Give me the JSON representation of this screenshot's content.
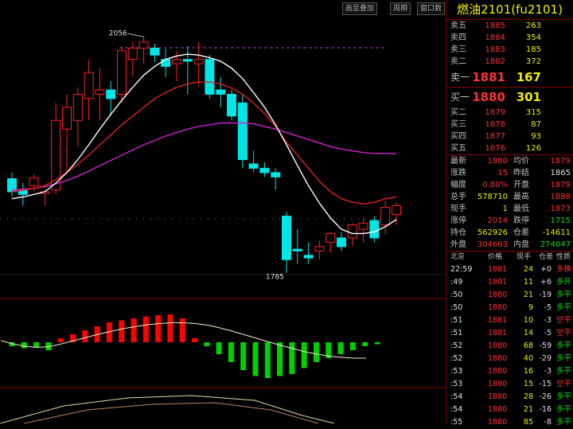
{
  "toolbar": {
    "buttons": [
      "画显叠加",
      "周期",
      "窗口数"
    ]
  },
  "chart": {
    "high_label": "2056",
    "low_label": "1785"
  },
  "colors": {
    "up": "#ff2020",
    "down": "#00e6e6",
    "ma_white": "#ffffff",
    "ma_red": "#e02020",
    "ma_magenta": "#d020d0",
    "macd_up": "#ff0000",
    "macd_down": "#00d000"
  },
  "panel": {
    "title": "燃油2101(fu2101)",
    "asks": [
      {
        "label": "卖五",
        "price": "1885",
        "vol": "263"
      },
      {
        "label": "卖四",
        "price": "1884",
        "vol": "354"
      },
      {
        "label": "卖三",
        "price": "1883",
        "vol": "185"
      },
      {
        "label": "卖二",
        "price": "1882",
        "vol": "372"
      },
      {
        "label": "卖一",
        "price": "1881",
        "vol": "167"
      }
    ],
    "bids": [
      {
        "label": "买一",
        "price": "1880",
        "vol": "301"
      },
      {
        "label": "买二",
        "price": "1879",
        "vol": "315"
      },
      {
        "label": "买三",
        "price": "1878",
        "vol": "87"
      },
      {
        "label": "买四",
        "price": "1877",
        "vol": "93"
      },
      {
        "label": "买五",
        "price": "1876",
        "vol": "126"
      }
    ],
    "stats": [
      {
        "l1": "最新",
        "v1": "1880",
        "l2": "均价",
        "v2": "1879"
      },
      {
        "l1": "涨跌",
        "v1": "15",
        "l2": "昨结",
        "v2": "1865"
      },
      {
        "l1": "幅度",
        "v1": "0.80%",
        "l2": "开盘",
        "v2": "1879"
      },
      {
        "l1": "总手",
        "v1": "578710",
        "l2": "最高",
        "v2": "1888"
      },
      {
        "l1": "现手",
        "v1": "1",
        "l2": "最低",
        "v2": "1873"
      },
      {
        "l1": "涨停",
        "v1": "2014",
        "l2": "跌停",
        "v2": "1715"
      },
      {
        "l1": "持仓",
        "v1": "562926",
        "l2": "仓差",
        "v2": "-14611"
      },
      {
        "l1": "外盘",
        "v1": "304663",
        "l2": "内盘",
        "v2": "274047"
      }
    ],
    "trade_headers": [
      "北京",
      "价格",
      "现手",
      "仓差",
      "性质"
    ],
    "trades": [
      {
        "time": "22:59",
        "price": "1881",
        "vol": "24",
        "diff": "+0",
        "nature": "多换"
      },
      {
        "time": ":49",
        "price": "1881",
        "vol": "11",
        "diff": "+6",
        "nature": "多开"
      },
      {
        "time": ":50",
        "price": "1880",
        "vol": "21",
        "diff": "-19",
        "nature": "多平"
      },
      {
        "time": ":50",
        "price": "1880",
        "vol": "9",
        "diff": "-5",
        "nature": "多平"
      },
      {
        "time": ":51",
        "price": "1881",
        "vol": "10",
        "diff": "-3",
        "nature": "空平"
      },
      {
        "time": ":51",
        "price": "1881",
        "vol": "14",
        "diff": "-5",
        "nature": "空平"
      },
      {
        "time": ":52",
        "price": "1880",
        "vol": "68",
        "diff": "-59",
        "nature": "多平"
      },
      {
        "time": ":52",
        "price": "1880",
        "vol": "40",
        "diff": "-29",
        "nature": "多平"
      },
      {
        "time": ":53",
        "price": "1880",
        "vol": "16",
        "diff": "-3",
        "nature": "多平"
      },
      {
        "time": ":53",
        "price": "1880",
        "vol": "15",
        "diff": "-15",
        "nature": "空平"
      },
      {
        "time": ":54",
        "price": "1880",
        "vol": "28",
        "diff": "-26",
        "nature": "多平"
      },
      {
        "time": ":54",
        "price": "1880",
        "vol": "21",
        "diff": "-16",
        "nature": "多平"
      },
      {
        "time": ":55",
        "price": "1880",
        "vol": "85",
        "diff": "-8",
        "nature": "多平"
      }
    ]
  },
  "chart_data": {
    "type": "candlestick",
    "title": "",
    "candles": [
      {
        "o": 1893,
        "h": 1900,
        "l": 1872,
        "c": 1878
      },
      {
        "o": 1880,
        "h": 1888,
        "l": 1862,
        "c": 1875
      },
      {
        "o": 1885,
        "h": 1898,
        "l": 1878,
        "c": 1894
      },
      {
        "o": 1876,
        "h": 1880,
        "l": 1862,
        "c": 1878
      },
      {
        "o": 1880,
        "h": 1980,
        "l": 1875,
        "c": 1960
      },
      {
        "o": 1950,
        "h": 1990,
        "l": 1900,
        "c": 1975
      },
      {
        "o": 1960,
        "h": 1998,
        "l": 1930,
        "c": 1990
      },
      {
        "o": 1985,
        "h": 2030,
        "l": 1960,
        "c": 2015
      },
      {
        "o": 1990,
        "h": 2020,
        "l": 1960,
        "c": 1995
      },
      {
        "o": 1995,
        "h": 2005,
        "l": 1965,
        "c": 1985
      },
      {
        "o": 1990,
        "h": 2045,
        "l": 1980,
        "c": 2040
      },
      {
        "o": 2030,
        "h": 2050,
        "l": 2010,
        "c": 2043
      },
      {
        "o": 2043,
        "h": 2056,
        "l": 2025,
        "c": 2050
      },
      {
        "o": 2043,
        "h": 2048,
        "l": 2027,
        "c": 2035
      },
      {
        "o": 2030,
        "h": 2042,
        "l": 2010,
        "c": 2022
      },
      {
        "o": 2025,
        "h": 2040,
        "l": 2005,
        "c": 2030
      },
      {
        "o": 2030,
        "h": 2045,
        "l": 1990,
        "c": 2028
      },
      {
        "o": 2025,
        "h": 2050,
        "l": 2000,
        "c": 2030
      },
      {
        "o": 2030,
        "h": 2035,
        "l": 1985,
        "c": 1990
      },
      {
        "o": 1995,
        "h": 2010,
        "l": 1975,
        "c": 1990
      },
      {
        "o": 1990,
        "h": 1995,
        "l": 1960,
        "c": 1965
      },
      {
        "o": 1980,
        "h": 1990,
        "l": 1905,
        "c": 1915
      },
      {
        "o": 1910,
        "h": 1925,
        "l": 1900,
        "c": 1905
      },
      {
        "o": 1905,
        "h": 1912,
        "l": 1895,
        "c": 1900
      },
      {
        "o": 1900,
        "h": 1905,
        "l": 1880,
        "c": 1895
      },
      {
        "o": 1850,
        "h": 1855,
        "l": 1785,
        "c": 1800
      },
      {
        "o": 1812,
        "h": 1835,
        "l": 1795,
        "c": 1810
      },
      {
        "o": 1805,
        "h": 1820,
        "l": 1795,
        "c": 1802
      },
      {
        "o": 1810,
        "h": 1822,
        "l": 1800,
        "c": 1815
      },
      {
        "o": 1820,
        "h": 1832,
        "l": 1808,
        "c": 1830
      },
      {
        "o": 1825,
        "h": 1832,
        "l": 1810,
        "c": 1815
      },
      {
        "o": 1825,
        "h": 1842,
        "l": 1815,
        "c": 1840
      },
      {
        "o": 1835,
        "h": 1848,
        "l": 1820,
        "c": 1842
      },
      {
        "o": 1845,
        "h": 1850,
        "l": 1820,
        "c": 1825
      },
      {
        "o": 1840,
        "h": 1868,
        "l": 1830,
        "c": 1860
      },
      {
        "o": 1852,
        "h": 1866,
        "l": 1840,
        "c": 1862
      }
    ],
    "ma_white": [
      1870,
      1872,
      1875,
      1878,
      1888,
      1900,
      1915,
      1932,
      1950,
      1967,
      1983,
      1998,
      2012,
      2022,
      2030,
      2034,
      2036,
      2035,
      2032,
      2028,
      2020,
      2008,
      1992,
      1975,
      1955,
      1932,
      1908,
      1885,
      1865,
      1848,
      1835,
      1830,
      1830,
      1832,
      1838,
      1846
    ],
    "ma_red": [
      1878,
      1880,
      1882,
      1885,
      1892,
      1900,
      1910,
      1920,
      1932,
      1943,
      1955,
      1965,
      1975,
      1985,
      1992,
      1998,
      2002,
      2004,
      2004,
      2002,
      1997,
      1990,
      1980,
      1968,
      1953,
      1935,
      1920,
      1905,
      1890,
      1878,
      1870,
      1866,
      1864,
      1866,
      1870,
      1872
    ],
    "ma_magenta": [
      1880,
      1881,
      1882,
      1884,
      1887,
      1891,
      1896,
      1902,
      1908,
      1914,
      1920,
      1926,
      1932,
      1937,
      1942,
      1946,
      1950,
      1953,
      1955,
      1957,
      1957,
      1957,
      1956,
      1953,
      1950,
      1946,
      1942,
      1938,
      1934,
      1930,
      1927,
      1925,
      1923,
      1922,
      1922,
      1922
    ],
    "macd_hist": [
      -1,
      -1.5,
      -1.2,
      -2,
      1,
      2,
      3,
      4,
      5,
      5.5,
      6,
      6.5,
      6.8,
      7,
      6,
      1,
      -1,
      -3,
      -5,
      -7,
      -8.5,
      -9,
      -8.5,
      -8,
      -6.5,
      -5,
      -4,
      -3,
      -2,
      -1,
      -0.5
    ],
    "macd_line": [
      2,
      1.2,
      0.6,
      0.3,
      0.5,
      1.2,
      2,
      2.8,
      3.6,
      4.3,
      5,
      5.5,
      6,
      6.3,
      6.5,
      6.5,
      6.3,
      5.9,
      5.2,
      4.4,
      3.5,
      2.6,
      1.7,
      0.8,
      0,
      -0.8,
      -1.4,
      -1.9,
      -2.2,
      -2.4,
      -2.4
    ]
  }
}
